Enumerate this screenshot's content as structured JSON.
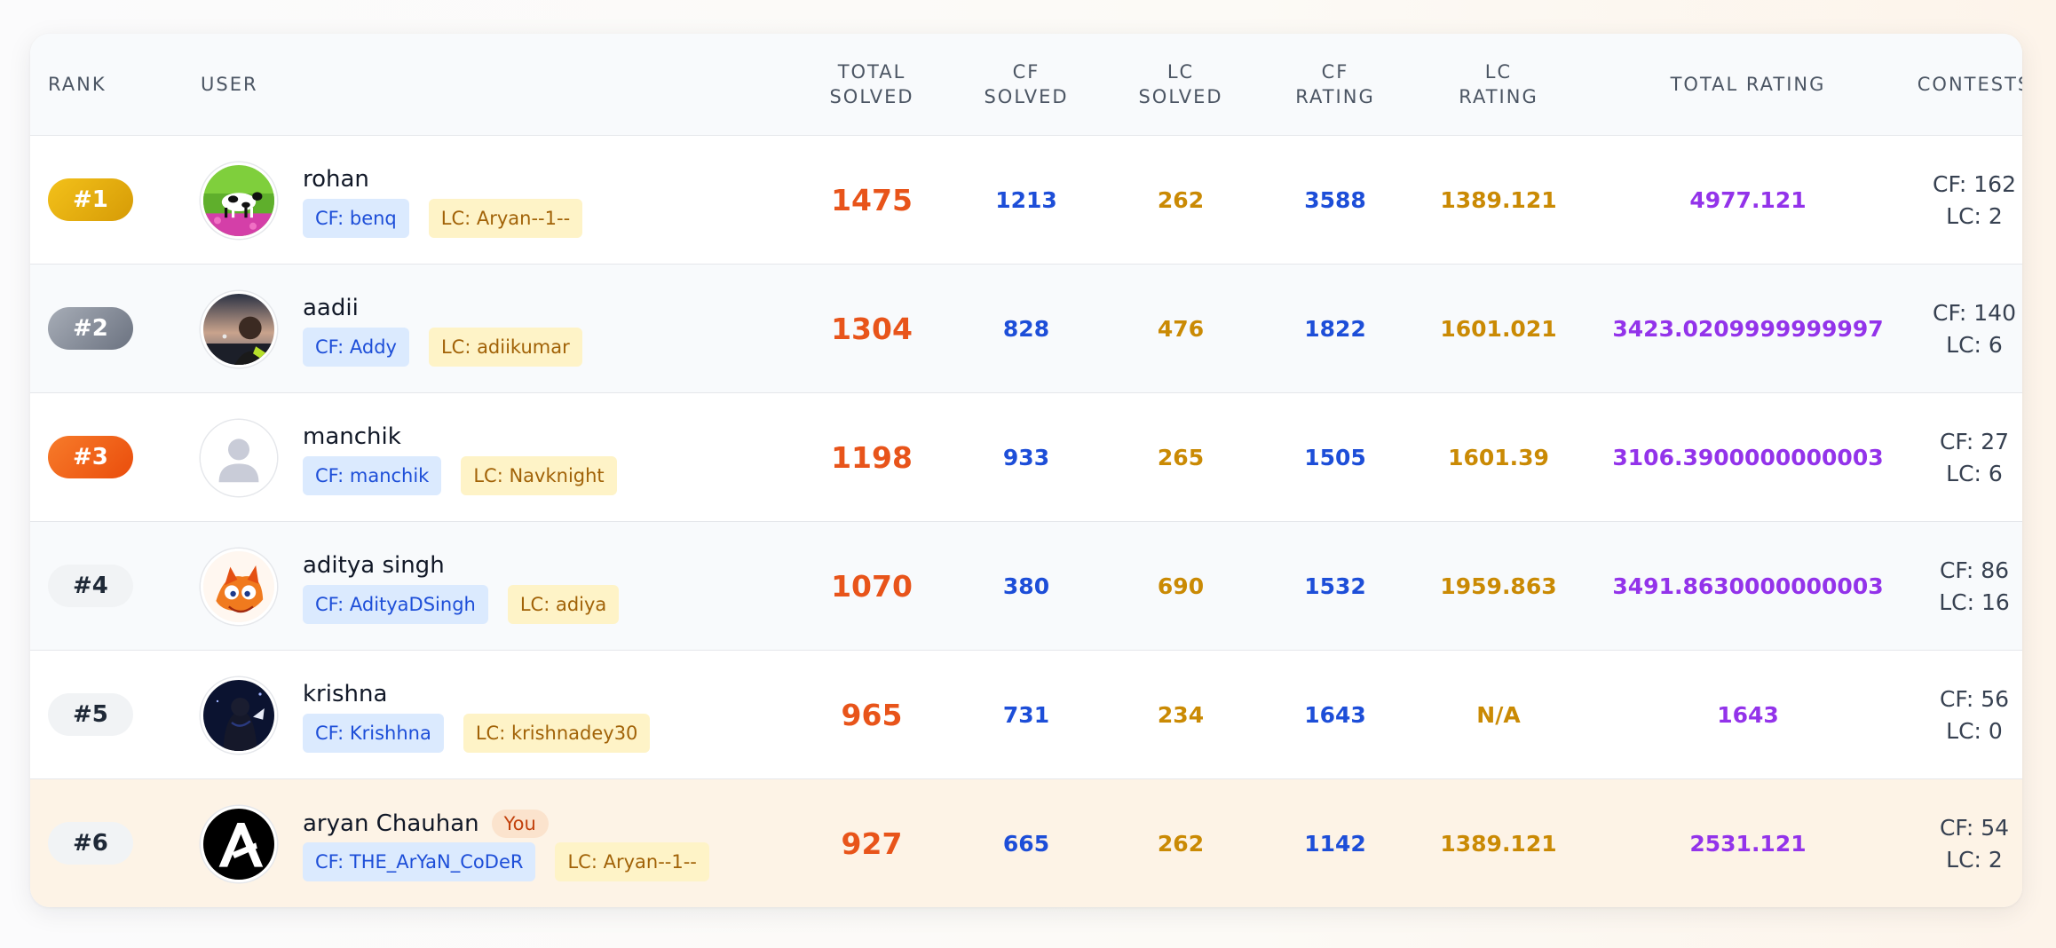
{
  "headers": {
    "rank": "RANK",
    "user": "USER",
    "total_solved": [
      "TOTAL",
      "SOLVED"
    ],
    "cf_solved": [
      "CF",
      "SOLVED"
    ],
    "lc_solved": [
      "LC",
      "SOLVED"
    ],
    "cf_rating": [
      "CF",
      "RATING"
    ],
    "lc_rating": [
      "LC",
      "RATING"
    ],
    "total_rating": "TOTAL RATING",
    "contests": "CONTESTS"
  },
  "rows": [
    {
      "rank": "#1",
      "name": "rohan",
      "cf": "CF: benq",
      "lc": "LC: Aryan--1--",
      "total": "1475",
      "cf_solved": "1213",
      "lc_solved": "262",
      "cf_rating": "3588",
      "lc_rating": "1389.121",
      "total_rating": "4977.121",
      "contests_cf": "CF: 162",
      "contests_lc": "LC: 2",
      "avatar": "cow-field-avatar",
      "you": ""
    },
    {
      "rank": "#2",
      "name": "aadii",
      "cf": "CF: Addy",
      "lc": "LC: adiikumar",
      "total": "1304",
      "cf_solved": "828",
      "lc_solved": "476",
      "cf_rating": "1822",
      "lc_rating": "1601.021",
      "total_rating": "3423.0209999999997",
      "contests_cf": "CF: 140",
      "contests_lc": "LC: 6",
      "avatar": "sunset-selfie-avatar",
      "you": ""
    },
    {
      "rank": "#3",
      "name": "manchik",
      "cf": "CF: manchik",
      "lc": "LC: Navknight",
      "total": "1198",
      "cf_solved": "933",
      "lc_solved": "265",
      "cf_rating": "1505",
      "lc_rating": "1601.39",
      "total_rating": "3106.3900000000003",
      "contests_cf": "CF: 27",
      "contests_lc": "LC: 6",
      "avatar": "default-user-avatar",
      "you": ""
    },
    {
      "rank": "#4",
      "name": "aditya singh",
      "cf": "CF: AdityaDSingh",
      "lc": "LC: adiya",
      "total": "1070",
      "cf_solved": "380",
      "lc_solved": "690",
      "cf_rating": "1532",
      "lc_rating": "1959.863",
      "total_rating": "3491.8630000000003",
      "contests_cf": "CF: 86",
      "contests_lc": "LC: 16",
      "avatar": "anime-fox-avatar",
      "you": ""
    },
    {
      "rank": "#5",
      "name": "krishna",
      "cf": "CF: Krishhna",
      "lc": "LC: krishnadey30",
      "total": "965",
      "cf_solved": "731",
      "lc_solved": "234",
      "cf_rating": "1643",
      "lc_rating": "N/A",
      "total_rating": "1643",
      "contests_cf": "CF: 56",
      "contests_lc": "LC: 0",
      "avatar": "dark-character-avatar",
      "you": ""
    },
    {
      "rank": "#6",
      "name": "aryan Chauhan",
      "cf": "CF: THE_ArYaN_CoDeR",
      "lc": "LC: Aryan--1--",
      "total": "927",
      "cf_solved": "665",
      "lc_solved": "262",
      "cf_rating": "1142",
      "lc_rating": "1389.121",
      "total_rating": "2531.121",
      "contests_cf": "CF: 54",
      "contests_lc": "LC: 2",
      "avatar": "letter-a-logo-avatar",
      "you": "You"
    }
  ],
  "colors": {
    "total_solved": "#e8541a",
    "cf": "#1d4ed8",
    "lc": "#ca8a04",
    "total_rating": "#9333ea",
    "gold": "#e5ac0f",
    "silver": "#8a919c",
    "bronze": "#f0621b",
    "current_user_row": "#fdf3e6"
  }
}
